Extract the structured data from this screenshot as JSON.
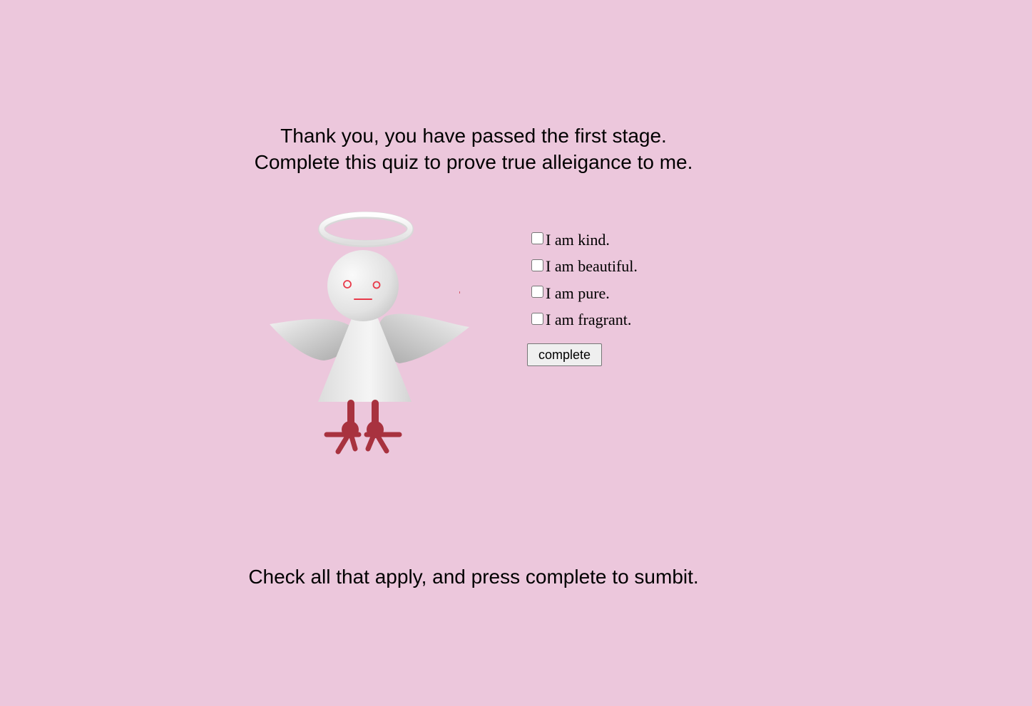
{
  "intro": {
    "line1": "Thank you, you have passed the first stage.",
    "line2": "Complete this quiz to prove true alleigance to me."
  },
  "figure": {
    "icon": "angel-figure",
    "body_color": "#e6e6e6",
    "feet_color": "#a8323f",
    "face_color": "#e83a4a"
  },
  "quiz": {
    "options": [
      {
        "label": "I am kind.",
        "checked": false
      },
      {
        "label": "I am beautiful.",
        "checked": false
      },
      {
        "label": "I am pure.",
        "checked": false
      },
      {
        "label": "I am fragrant.",
        "checked": false
      }
    ],
    "submit_label": "complete"
  },
  "instruction": "Check all that apply, and press complete to sumbit.",
  "colors": {
    "background": "#ecc7dc",
    "button_bg": "#efefef"
  }
}
